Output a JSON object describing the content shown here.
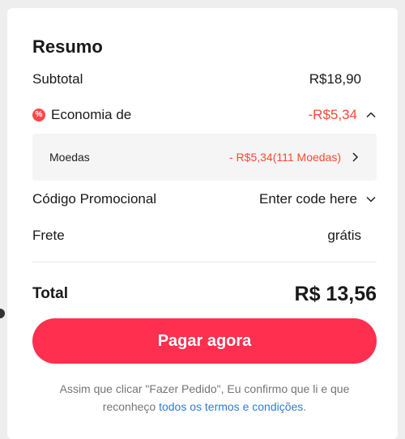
{
  "summary": {
    "title": "Resumo",
    "subtotal_label": "Subtotal",
    "subtotal_value": "R$18,90",
    "saving_label": "Economia de",
    "saving_value": "-R$5,34",
    "coins_label": "Moedas",
    "coins_value": "- R$5,34(111 Moedas)",
    "promo_label": "Código Promocional",
    "promo_placeholder": "Enter code here",
    "shipping_label": "Frete",
    "shipping_value": "grátis",
    "total_label": "Total",
    "total_value": "R$ 13,56",
    "pay_button_label": "Pagar agora",
    "terms_text": "Assim que clicar \"Fazer Pedido\", Eu confirmo que li e que reconheço",
    "terms_link": "todos os termos e condições",
    "terms_end": "."
  },
  "icons": {
    "discount_badge": "discount-percent-icon",
    "saving_toggle": "chevron-up-icon",
    "coins_more": "chevron-right-icon",
    "promo_toggle": "chevron-down-icon"
  },
  "colors": {
    "accent_red": "#ff4733",
    "pay_button": "#fe2f4f",
    "link_blue": "#2e7bd7"
  }
}
